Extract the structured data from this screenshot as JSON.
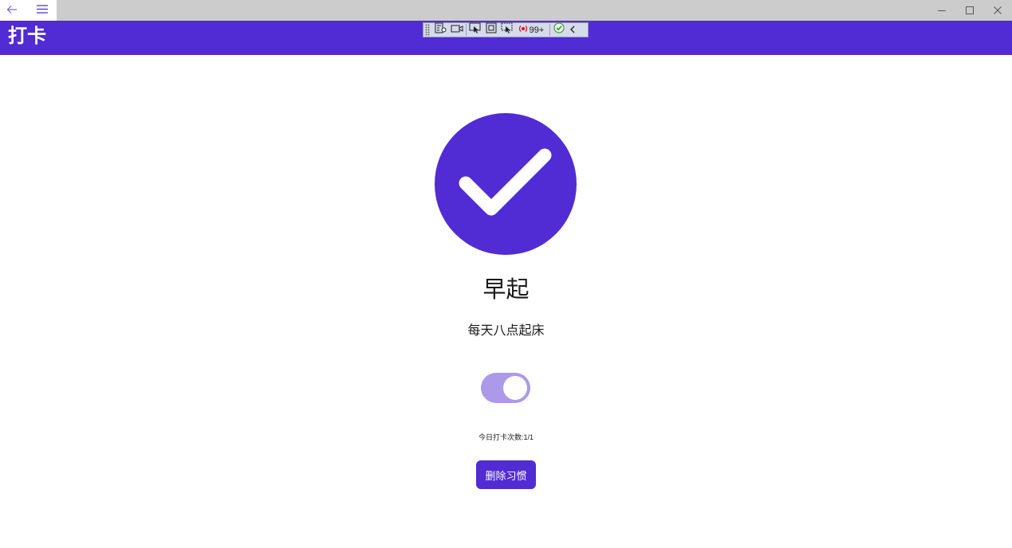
{
  "header": {
    "title": "打卡"
  },
  "debug_toolbar": {
    "badge_count": "99+"
  },
  "habit": {
    "name": "早起",
    "description": "每天八点起床",
    "completed": true,
    "count_text": "今日打卡次数:1/1"
  },
  "actions": {
    "delete_label": "删除习惯"
  },
  "colors": {
    "accent": "#512bd4",
    "toggle_track": "#ac99ea",
    "titlebar": "#cccccc"
  }
}
